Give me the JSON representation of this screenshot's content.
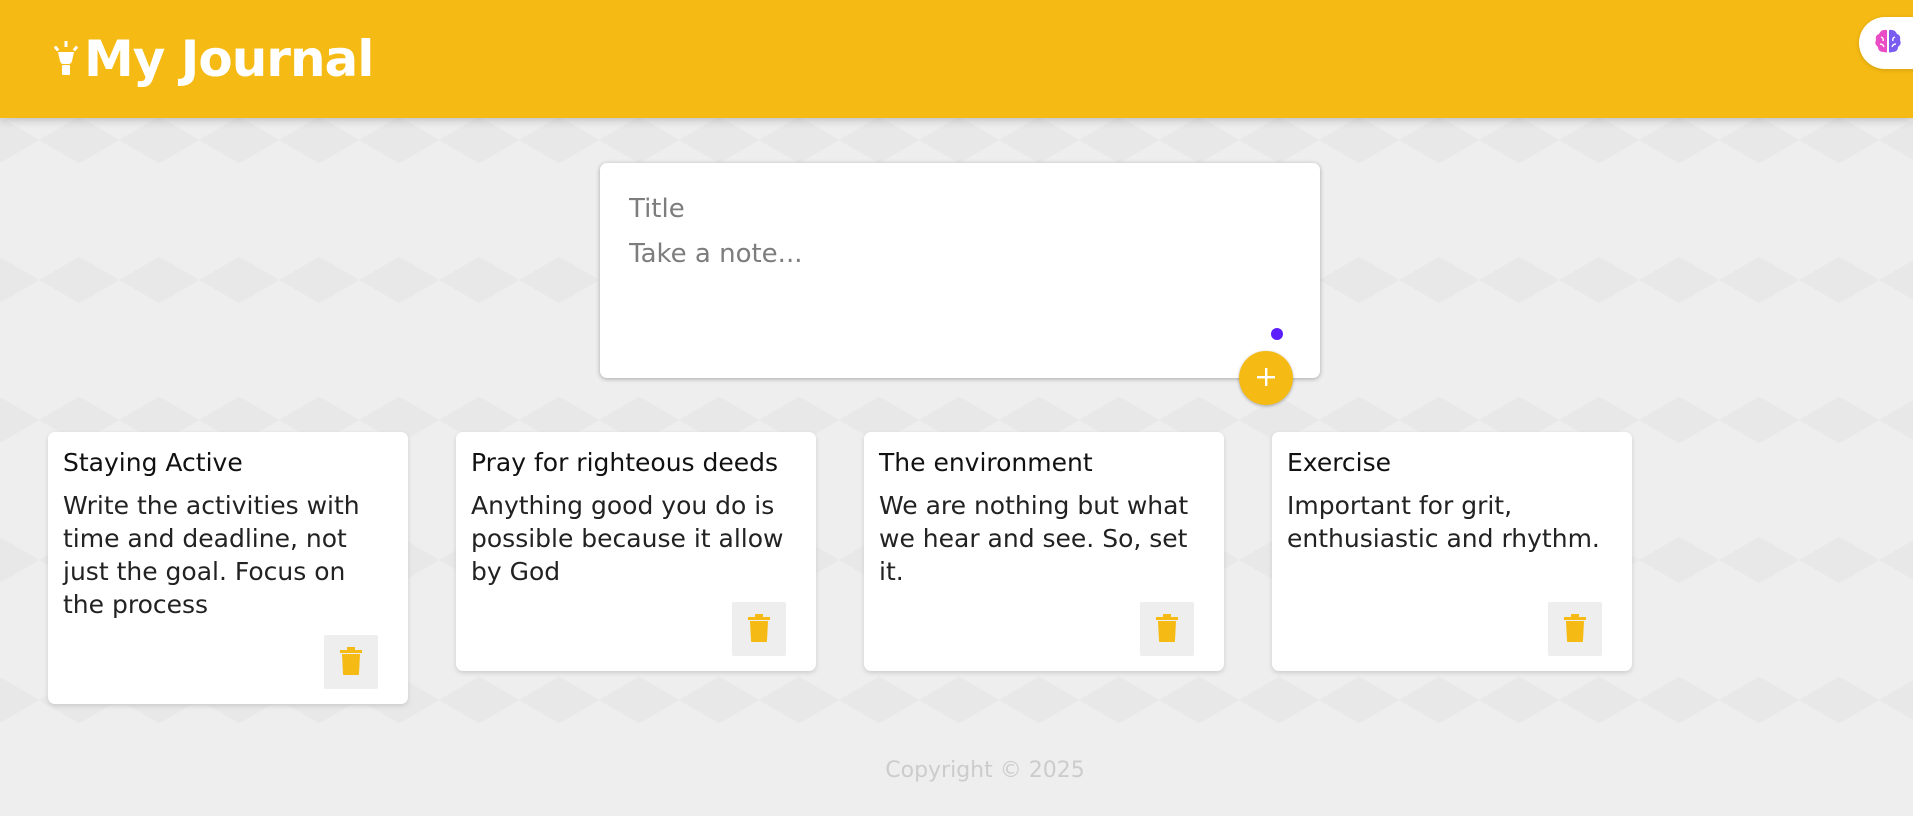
{
  "header": {
    "title": "My Journal",
    "logo_icon": "lightbulb-icon",
    "ai_icon": "brain-icon",
    "accent_color": "#f5ba13"
  },
  "create_area": {
    "title_placeholder": "Title",
    "content_placeholder": "Take a note...",
    "add_icon": "plus-icon"
  },
  "notes": [
    {
      "title": "Staying Active",
      "content": "Write the activities with time and deadline, not just the goal. Focus on the process"
    },
    {
      "title": "Pray for righteous deeds",
      "content": "Anything good you do is possible because it allow by God"
    },
    {
      "title": "The environment",
      "content": "We are nothing but what we hear and see. So, set it."
    },
    {
      "title": "Exercise",
      "content": "Important for grit, enthusiastic and rhythm."
    }
  ],
  "footer": {
    "copyright": "Copyright © 2025"
  }
}
